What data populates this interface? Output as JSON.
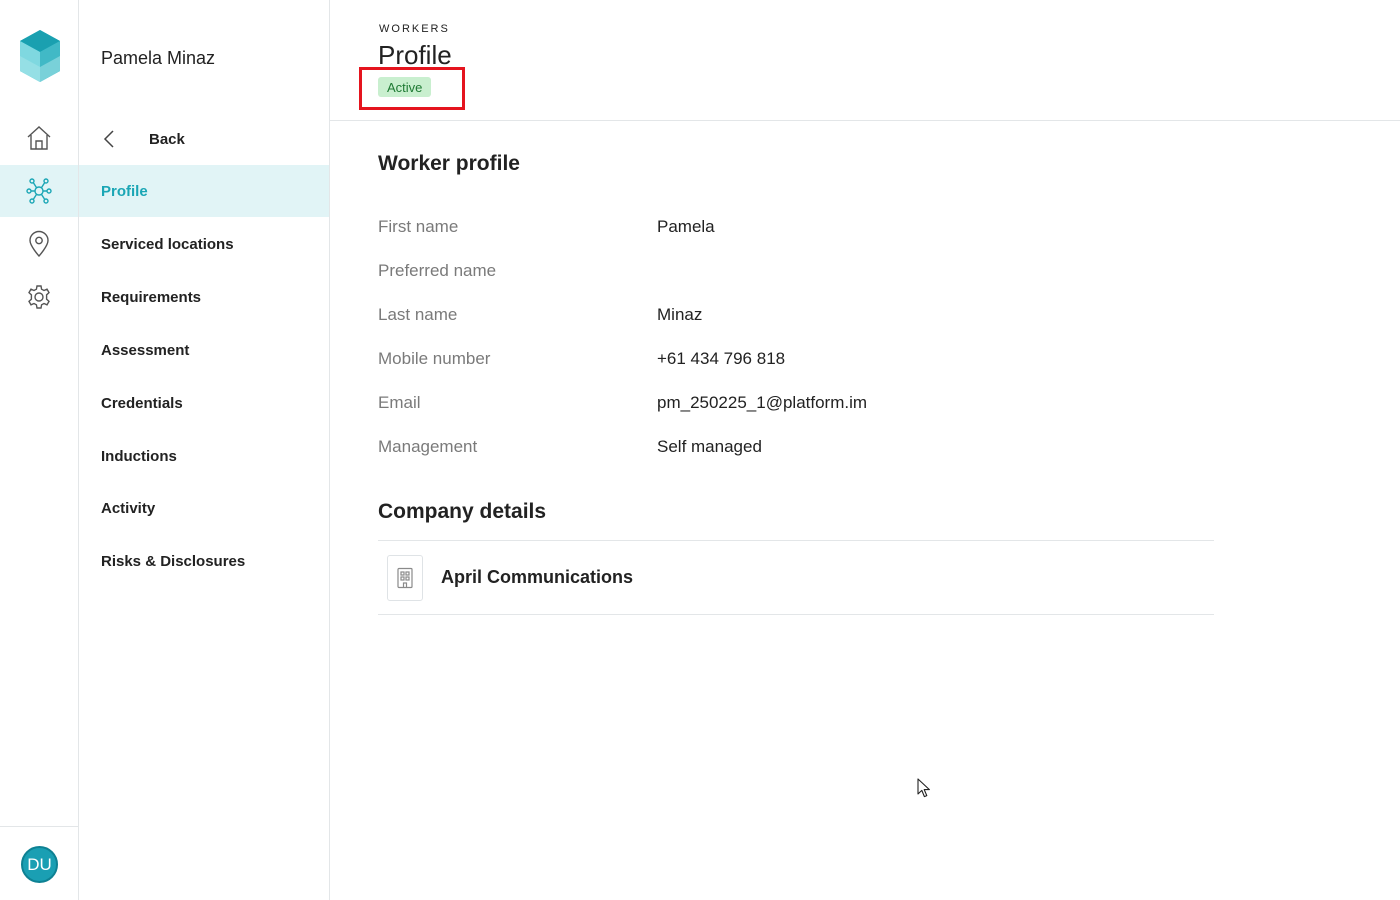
{
  "rail": {
    "items": [
      {
        "icon": "home-icon"
      },
      {
        "icon": "network-icon",
        "active": true
      },
      {
        "icon": "location-pin-icon"
      },
      {
        "icon": "gear-icon"
      }
    ],
    "avatar_initials": "DU",
    "accent": "#1aa6b5"
  },
  "subnav": {
    "worker_name": "Pamela Minaz",
    "back_label": "Back",
    "items": [
      {
        "label": "Profile",
        "active": true
      },
      {
        "label": "Serviced locations"
      },
      {
        "label": "Requirements"
      },
      {
        "label": "Assessment"
      },
      {
        "label": "Credentials"
      },
      {
        "label": "Inductions"
      },
      {
        "label": "Activity"
      },
      {
        "label": "Risks & Disclosures"
      }
    ]
  },
  "header": {
    "eyebrow": "WORKERS",
    "title": "Profile",
    "status": "Active",
    "status_color": "#c9efcf"
  },
  "worker_profile": {
    "title": "Worker profile",
    "fields": [
      {
        "label": "First name",
        "value": "Pamela"
      },
      {
        "label": "Preferred name",
        "value": ""
      },
      {
        "label": "Last name",
        "value": "Minaz"
      },
      {
        "label": "Mobile number",
        "value": "+61 434 796 818"
      },
      {
        "label": "Email",
        "value": "pm_250225_1@platform.im"
      },
      {
        "label": "Management",
        "value": "Self managed"
      }
    ]
  },
  "company_details": {
    "title": "Company details",
    "company_name": "April Communications",
    "icon": "building-icon"
  }
}
